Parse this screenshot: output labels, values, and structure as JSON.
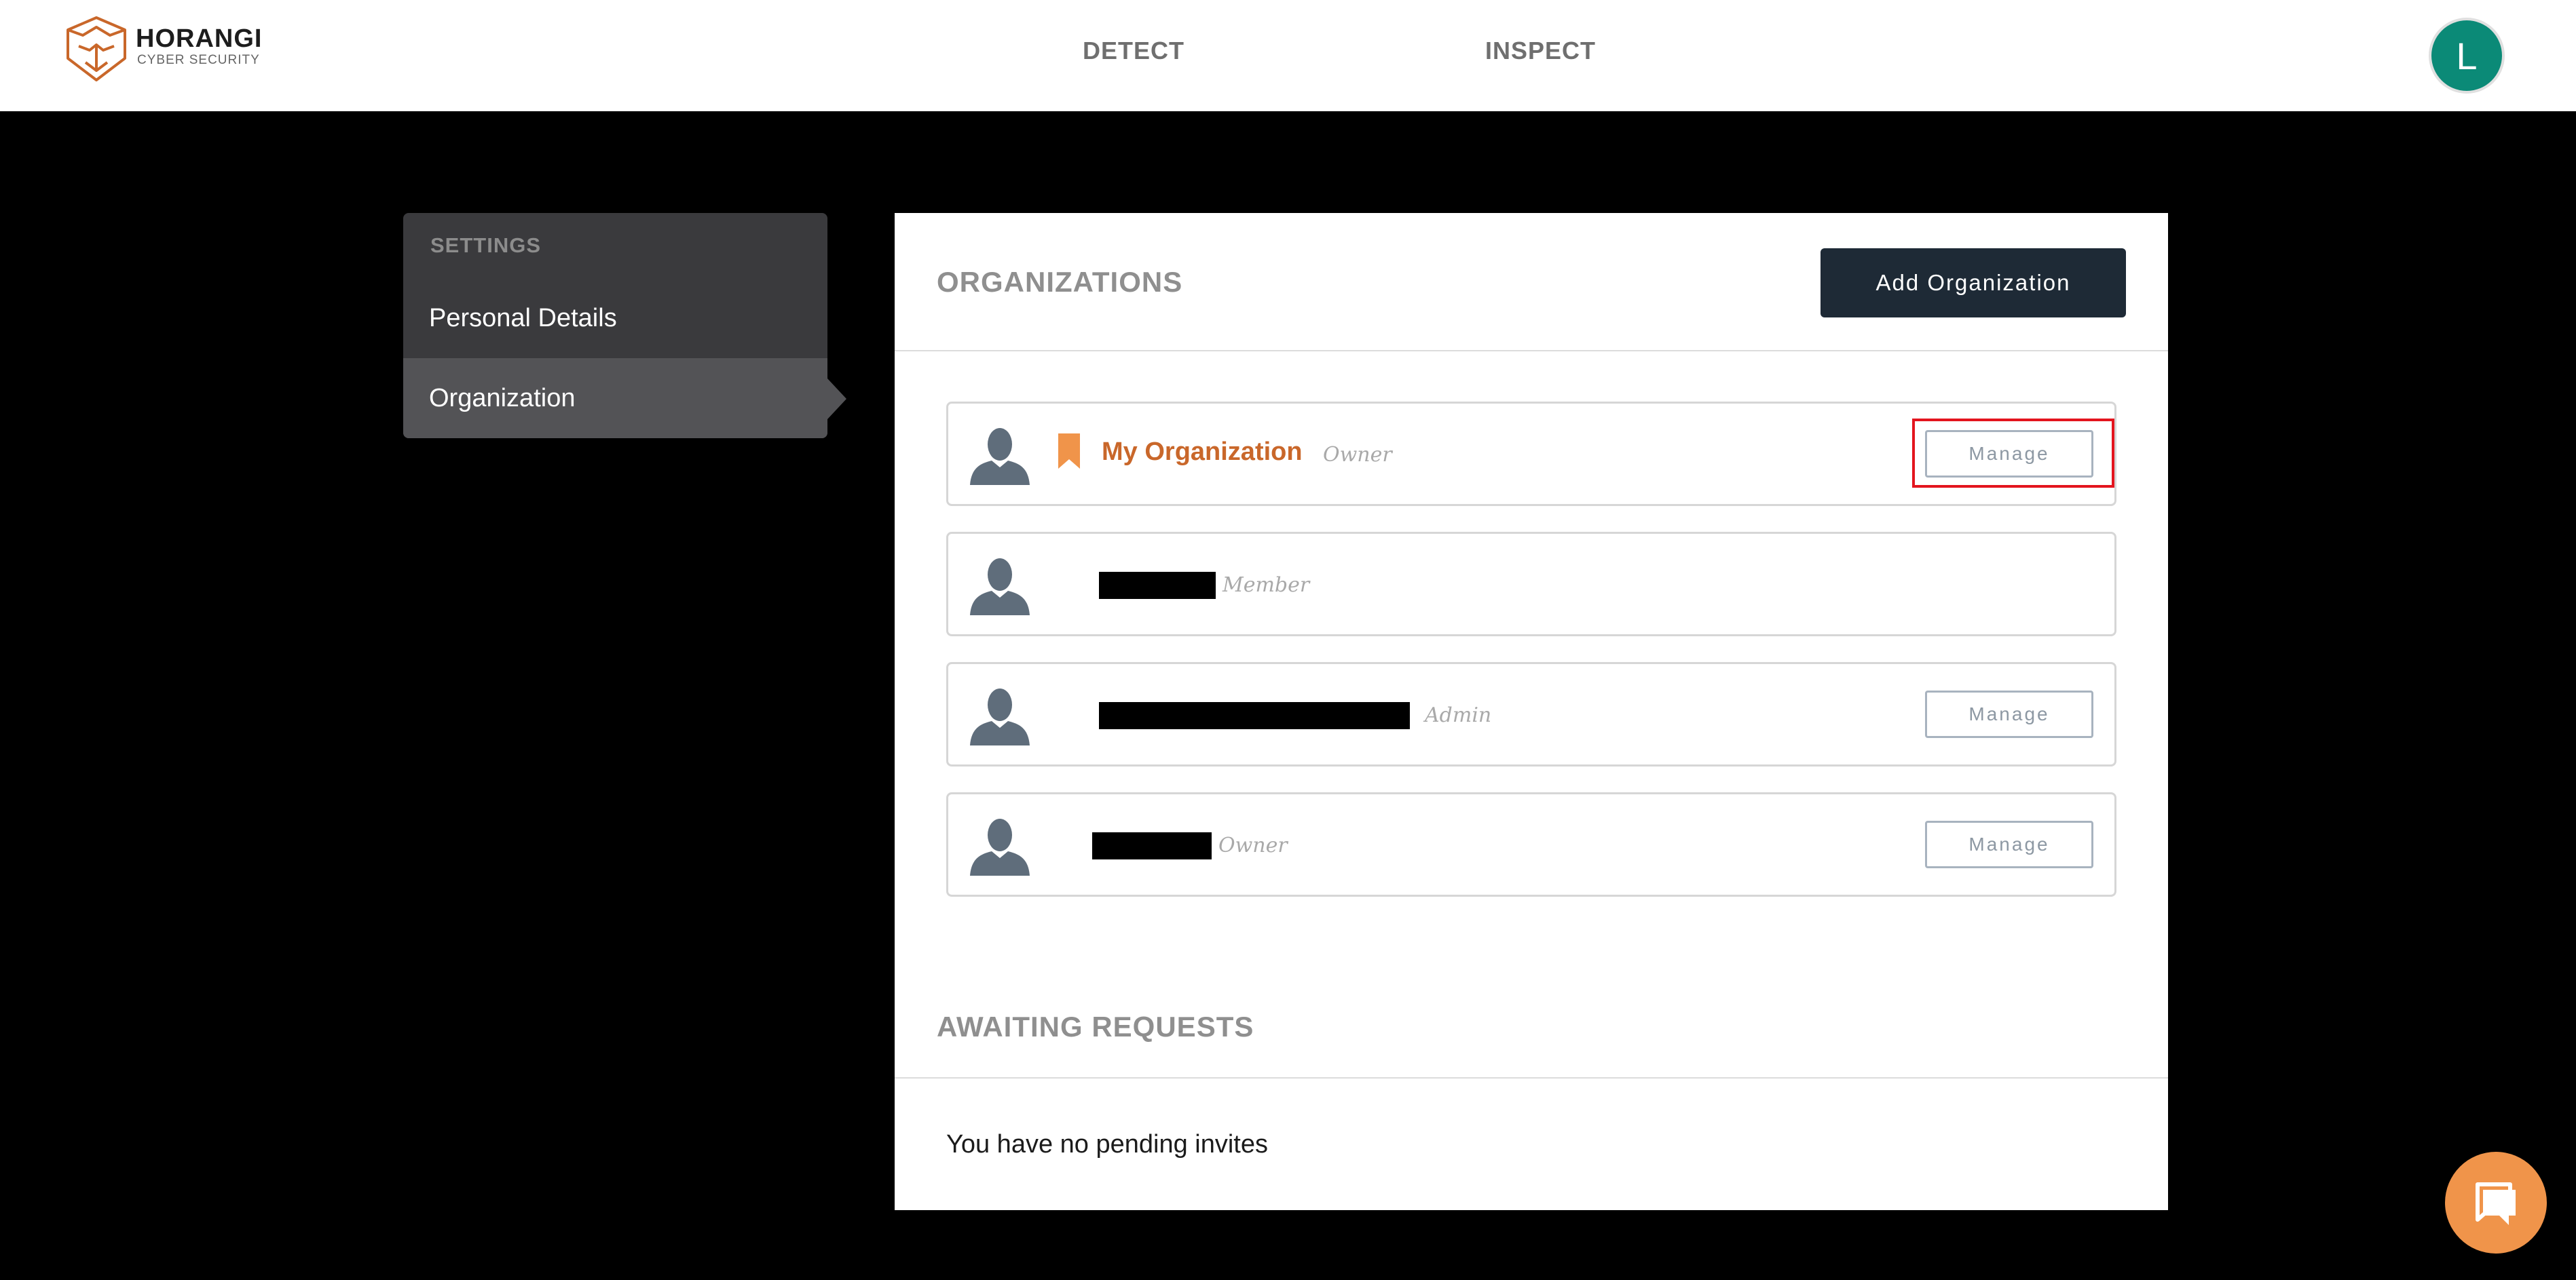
{
  "brand": {
    "name": "HORANGI",
    "tagline": "CYBER SECURITY"
  },
  "nav": {
    "detect": "DETECT",
    "inspect": "INSPECT"
  },
  "user": {
    "avatar_initial": "L",
    "avatar_color": "#0b8a77"
  },
  "sidebar": {
    "heading": "SETTINGS",
    "items": [
      {
        "label": "Personal Details",
        "active": false
      },
      {
        "label": "Organization",
        "active": true
      }
    ]
  },
  "organizations": {
    "title": "ORGANIZATIONS",
    "add_button": "Add Organization",
    "rows": [
      {
        "name": "My Organization",
        "role": "Owner",
        "default": true,
        "manage": "Manage"
      },
      {
        "name": "",
        "role": "Member",
        "redacted": true
      },
      {
        "name": "",
        "role": "Admin",
        "redacted": true,
        "manage": "Manage"
      },
      {
        "name": "",
        "role": "Owner",
        "redacted": true,
        "manage": "Manage"
      }
    ]
  },
  "awaiting": {
    "title": "AWAITING REQUESTS",
    "empty_text": "You have no pending invites"
  },
  "colors": {
    "accent_orange": "#c9672a",
    "primary_button": "#1e2a36",
    "chat_button": "#f0944a",
    "highlight": "#e3151e"
  },
  "icons": [
    "tiger-logo-icon",
    "person-icon",
    "bookmark-icon",
    "chat-icon"
  ]
}
